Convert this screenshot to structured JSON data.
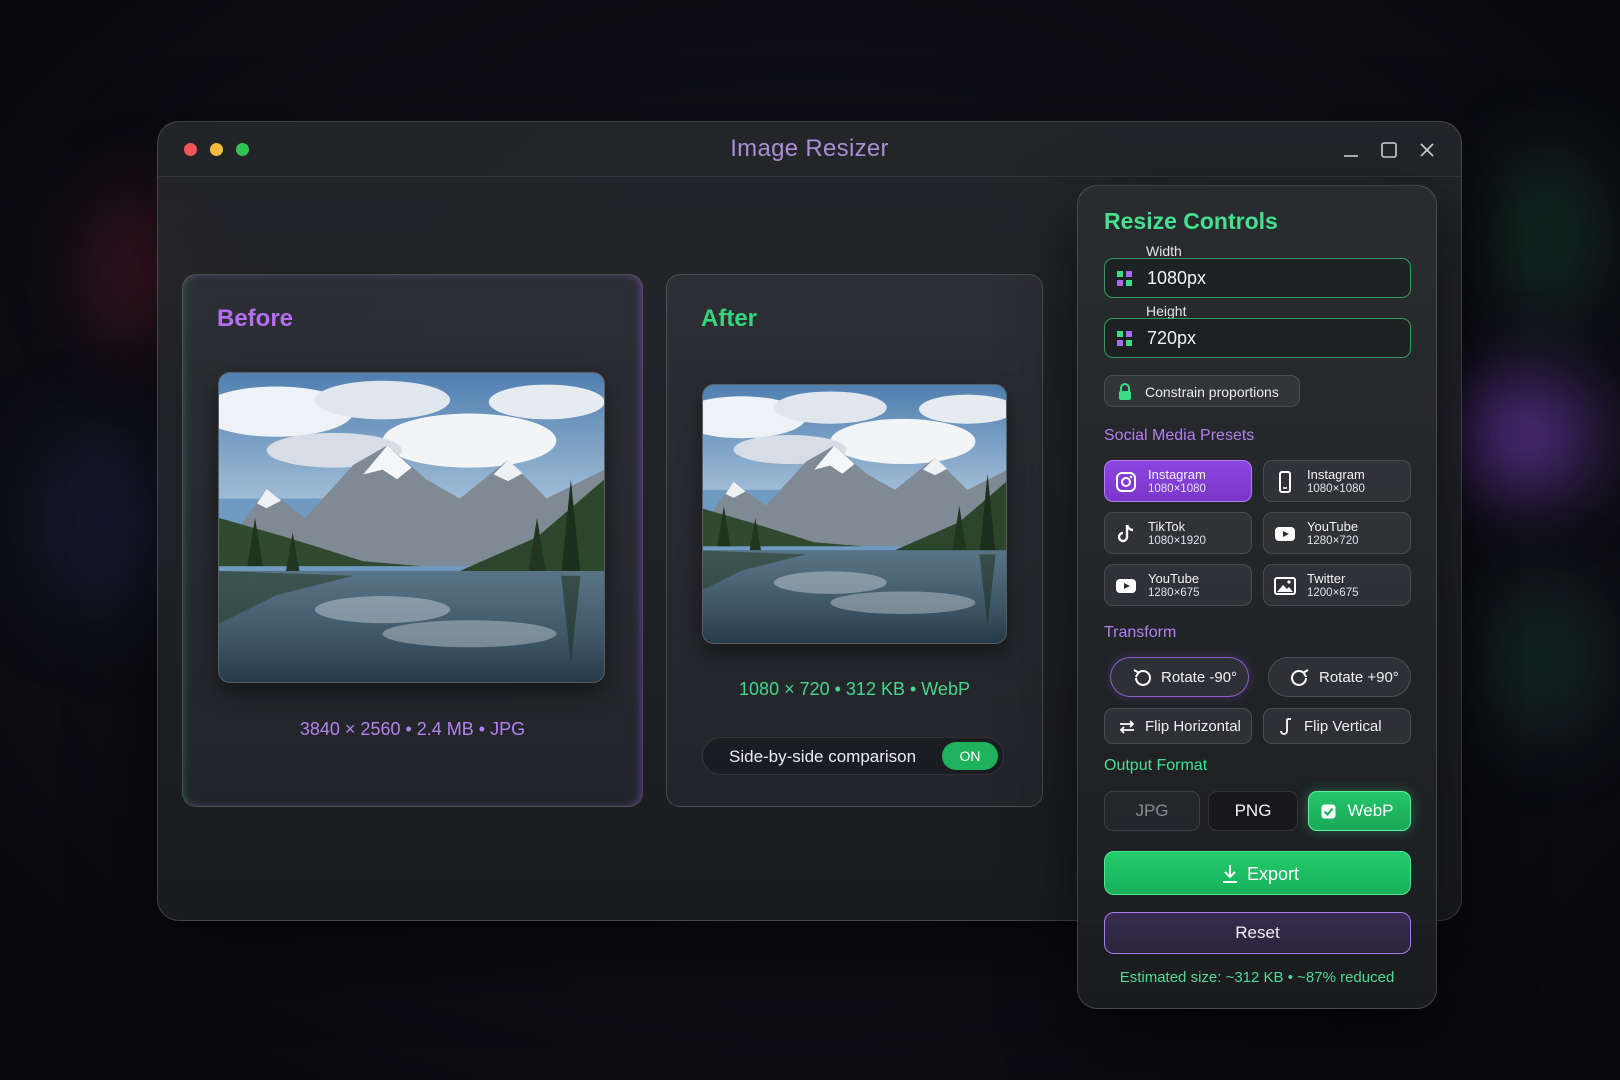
{
  "window": {
    "title": "Image Resizer"
  },
  "before": {
    "title": "Before",
    "meta": "3840 × 2560 • 2.4 MB • JPG"
  },
  "after": {
    "title": "After",
    "meta": "1080 × 720 • 312 KB • WebP",
    "comparison_label": "Side-by-side comparison",
    "comparison_state": "ON"
  },
  "controls": {
    "title": "Resize Controls",
    "width_label": "Width",
    "width_value": "1080px",
    "height_label": "Height",
    "height_value": "720px",
    "constrain_label": "Constrain proportions",
    "presets_title": "Social Media Presets",
    "presets": [
      {
        "name": "Instagram",
        "size": "1080×1080",
        "icon": "instagram-icon",
        "active": true
      },
      {
        "name": "Instagram",
        "size": "1080×1080",
        "icon": "phone-icon",
        "active": false
      },
      {
        "name": "TikTok",
        "size": "1080×1920",
        "icon": "tiktok-icon",
        "active": false
      },
      {
        "name": "YouTube",
        "size": "1280×720",
        "icon": "youtube-icon",
        "active": false
      },
      {
        "name": "YouTube",
        "size": "1280×675",
        "icon": "youtube-icon",
        "active": false
      },
      {
        "name": "Twitter",
        "size": "1200×675",
        "icon": "image-icon",
        "active": false
      }
    ],
    "transform_title": "Transform",
    "rotate_left": "Rotate -90°",
    "rotate_right": "Rotate +90°",
    "flip_h": "Flip Horizontal",
    "flip_v": "Flip Vertical",
    "output_title": "Output Format",
    "formats": [
      "JPG",
      "PNG",
      "WebP"
    ],
    "selected_format": "WebP",
    "export_label": "Export",
    "reset_label": "Reset",
    "estimate": "Estimated size: ~312 KB • ~87% reduced"
  },
  "colors": {
    "accent_green": "#22cc6c",
    "accent_purple": "#8c45e0",
    "title_purple": "#a98ed6"
  }
}
